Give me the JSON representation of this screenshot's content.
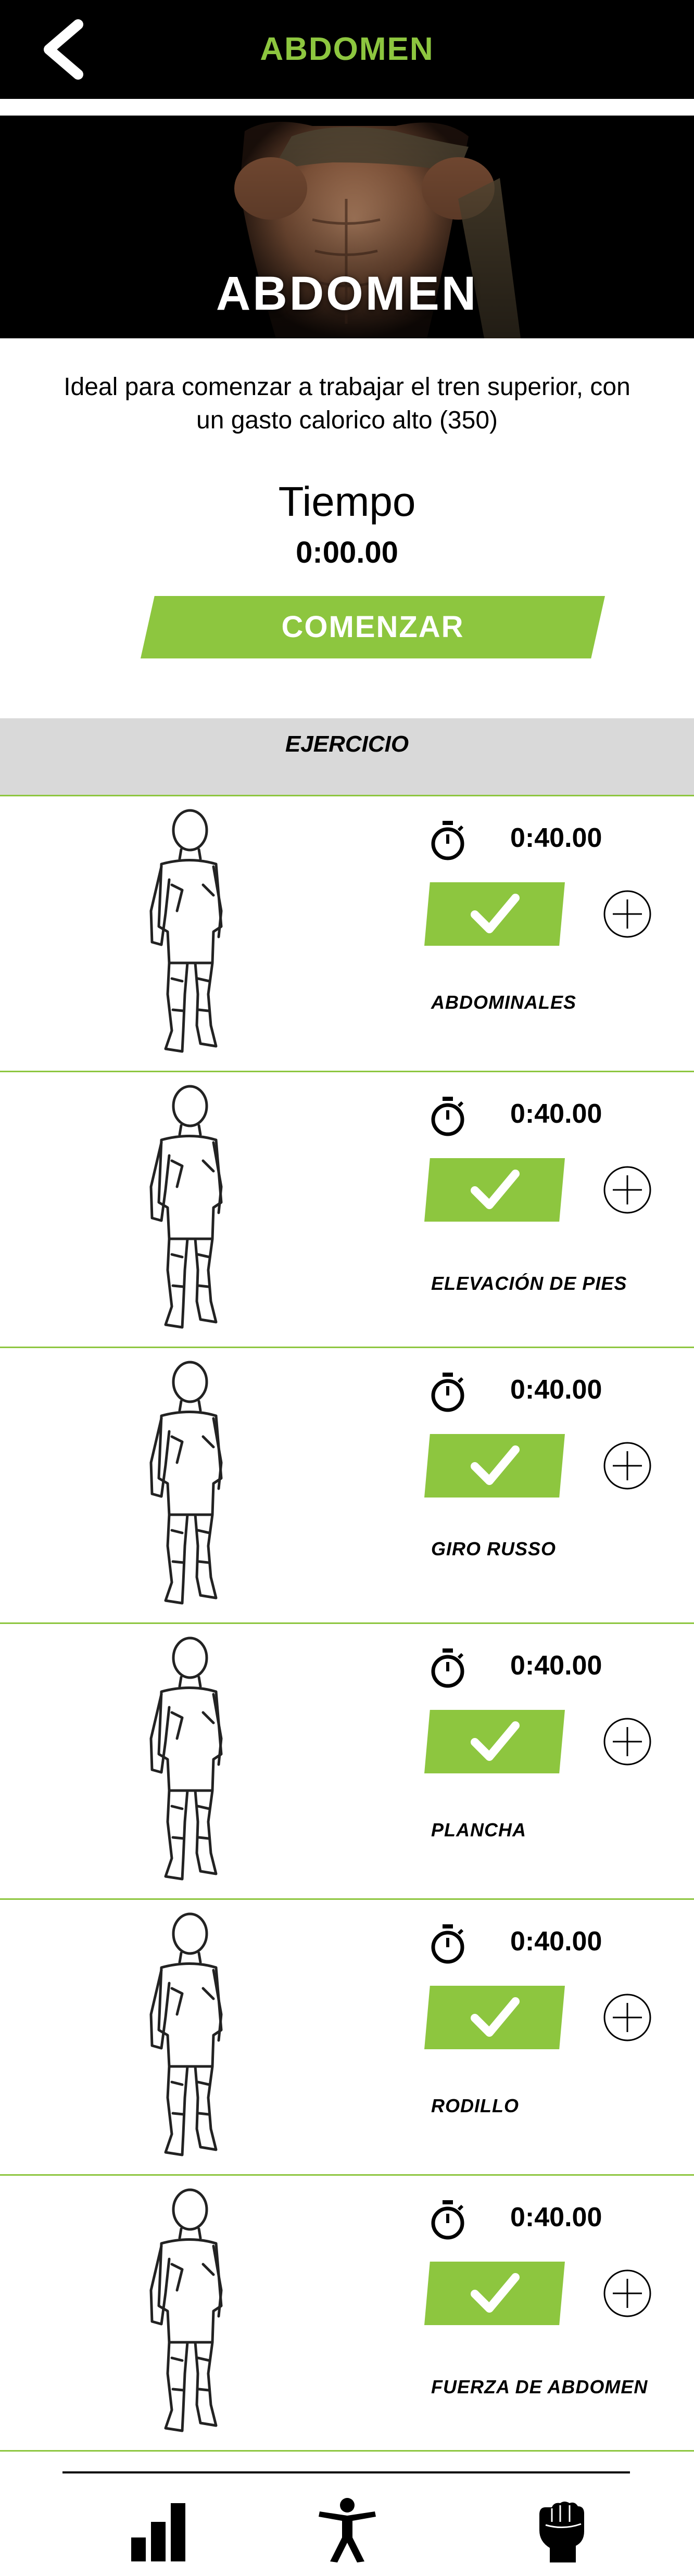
{
  "header": {
    "title": "ABDOMEN",
    "back_icon": "chevron-left-icon"
  },
  "hero": {
    "title": "ABDOMEN"
  },
  "description": "Ideal para comenzar a trabajar el tren superior, con un gasto calorico alto (350)",
  "timer": {
    "label": "Tiempo",
    "value": "0:00.00"
  },
  "start_button": {
    "label": "COMENZAR"
  },
  "section": {
    "header": "EJERCICIO"
  },
  "exercises": [
    {
      "name": "ABDOMINALES",
      "time": "0:40.00"
    },
    {
      "name": "ELEVACIÓN DE PIES",
      "time": "0:40.00"
    },
    {
      "name": "GIRO RUSSO",
      "time": "0:40.00"
    },
    {
      "name": "PLANCHA",
      "time": "0:40.00"
    },
    {
      "name": "RODILLO",
      "time": "0:40.00"
    },
    {
      "name": "FUERZA DE ABDOMEN",
      "time": "0:40.00"
    }
  ],
  "bottom_nav": {
    "items": [
      {
        "icon": "bar-chart-icon"
      },
      {
        "icon": "person-icon"
      },
      {
        "icon": "fist-icon"
      }
    ]
  },
  "colors": {
    "accent": "#8dc63f",
    "bar": "#000000",
    "section_bg": "#d9d9d9"
  }
}
